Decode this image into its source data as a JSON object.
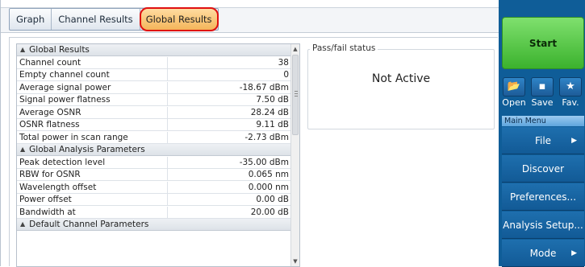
{
  "tabs": [
    "Graph",
    "Channel Results",
    "Global Results"
  ],
  "results": [
    {
      "type": "section",
      "label": "Global Results"
    },
    {
      "type": "row",
      "label": "Channel count",
      "value": "38"
    },
    {
      "type": "row",
      "label": "Empty channel count",
      "value": "0"
    },
    {
      "type": "row",
      "label": "Average signal power",
      "value": "-18.67 dBm"
    },
    {
      "type": "row",
      "label": "Signal power flatness",
      "value": "7.50 dB"
    },
    {
      "type": "row",
      "label": "Average OSNR",
      "value": "28.24 dB"
    },
    {
      "type": "row",
      "label": "OSNR flatness",
      "value": "9.11 dB"
    },
    {
      "type": "row",
      "label": "Total power in scan range",
      "value": "-2.73 dBm"
    },
    {
      "type": "section",
      "label": "Global Analysis Parameters"
    },
    {
      "type": "row",
      "label": "Peak detection level",
      "value": "-35.00 dBm"
    },
    {
      "type": "row",
      "label": "RBW for OSNR",
      "value": "0.065 nm"
    },
    {
      "type": "row",
      "label": "Wavelength offset",
      "value": "0.000 nm"
    },
    {
      "type": "row",
      "label": "Power offset",
      "value": "0.00 dB"
    },
    {
      "type": "row",
      "label": "Bandwidth at",
      "value": "20.00 dB"
    },
    {
      "type": "section",
      "label": "Default Channel Parameters"
    }
  ],
  "passfail": {
    "title": "Pass/fail status",
    "status": "Not Active"
  },
  "sidebar": {
    "start_label": "Start",
    "quick_actions": [
      {
        "label": "Open",
        "icon": "folder-icon",
        "glyph": "📂"
      },
      {
        "label": "Save",
        "icon": "save-icon",
        "glyph": "▪"
      },
      {
        "label": "Fav.",
        "icon": "star-icon",
        "glyph": "★"
      }
    ],
    "menu_header": "Main Menu",
    "menu": [
      {
        "label": "File",
        "submenu": true
      },
      {
        "label": "Discover",
        "submenu": false
      },
      {
        "label": "Preferences...",
        "submenu": false
      },
      {
        "label": "Analysis Setup...",
        "submenu": false
      },
      {
        "label": "Mode",
        "submenu": true
      }
    ]
  },
  "colors": {
    "accent": "#0f5d98",
    "start": "#3bb22d",
    "active_tab": "#f4b55a",
    "highlight_ring": "#e01010"
  }
}
